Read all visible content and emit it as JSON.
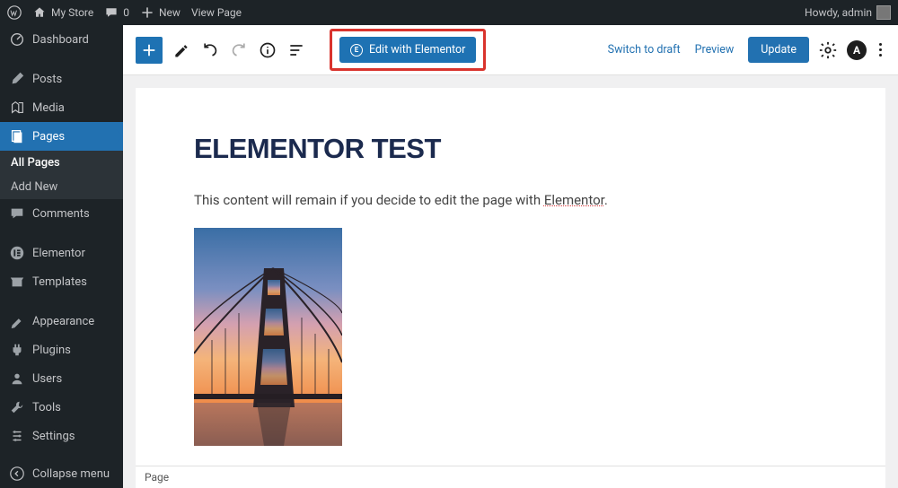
{
  "adminbar": {
    "site_name": "My Store",
    "comments_count": "0",
    "new_label": "New",
    "view_page": "View Page",
    "howdy": "Howdy, admin"
  },
  "sidebar": {
    "dashboard": "Dashboard",
    "posts": "Posts",
    "media": "Media",
    "pages": "Pages",
    "pages_sub": {
      "all": "All Pages",
      "add": "Add New"
    },
    "comments": "Comments",
    "elementor": "Elementor",
    "templates": "Templates",
    "appearance": "Appearance",
    "plugins": "Plugins",
    "users": "Users",
    "tools": "Tools",
    "settings": "Settings",
    "collapse": "Collapse menu"
  },
  "toolbar": {
    "edit_elementor": "Edit with Elementor",
    "switch_draft": "Switch to draft",
    "preview": "Preview",
    "update": "Update"
  },
  "content": {
    "title": "ELEMENTOR TEST",
    "paragraph_pre": "This content will remain if you decide to edit the page with ",
    "paragraph_link": "Elementor",
    "paragraph_post": "."
  },
  "bottombar": {
    "page": "Page"
  }
}
